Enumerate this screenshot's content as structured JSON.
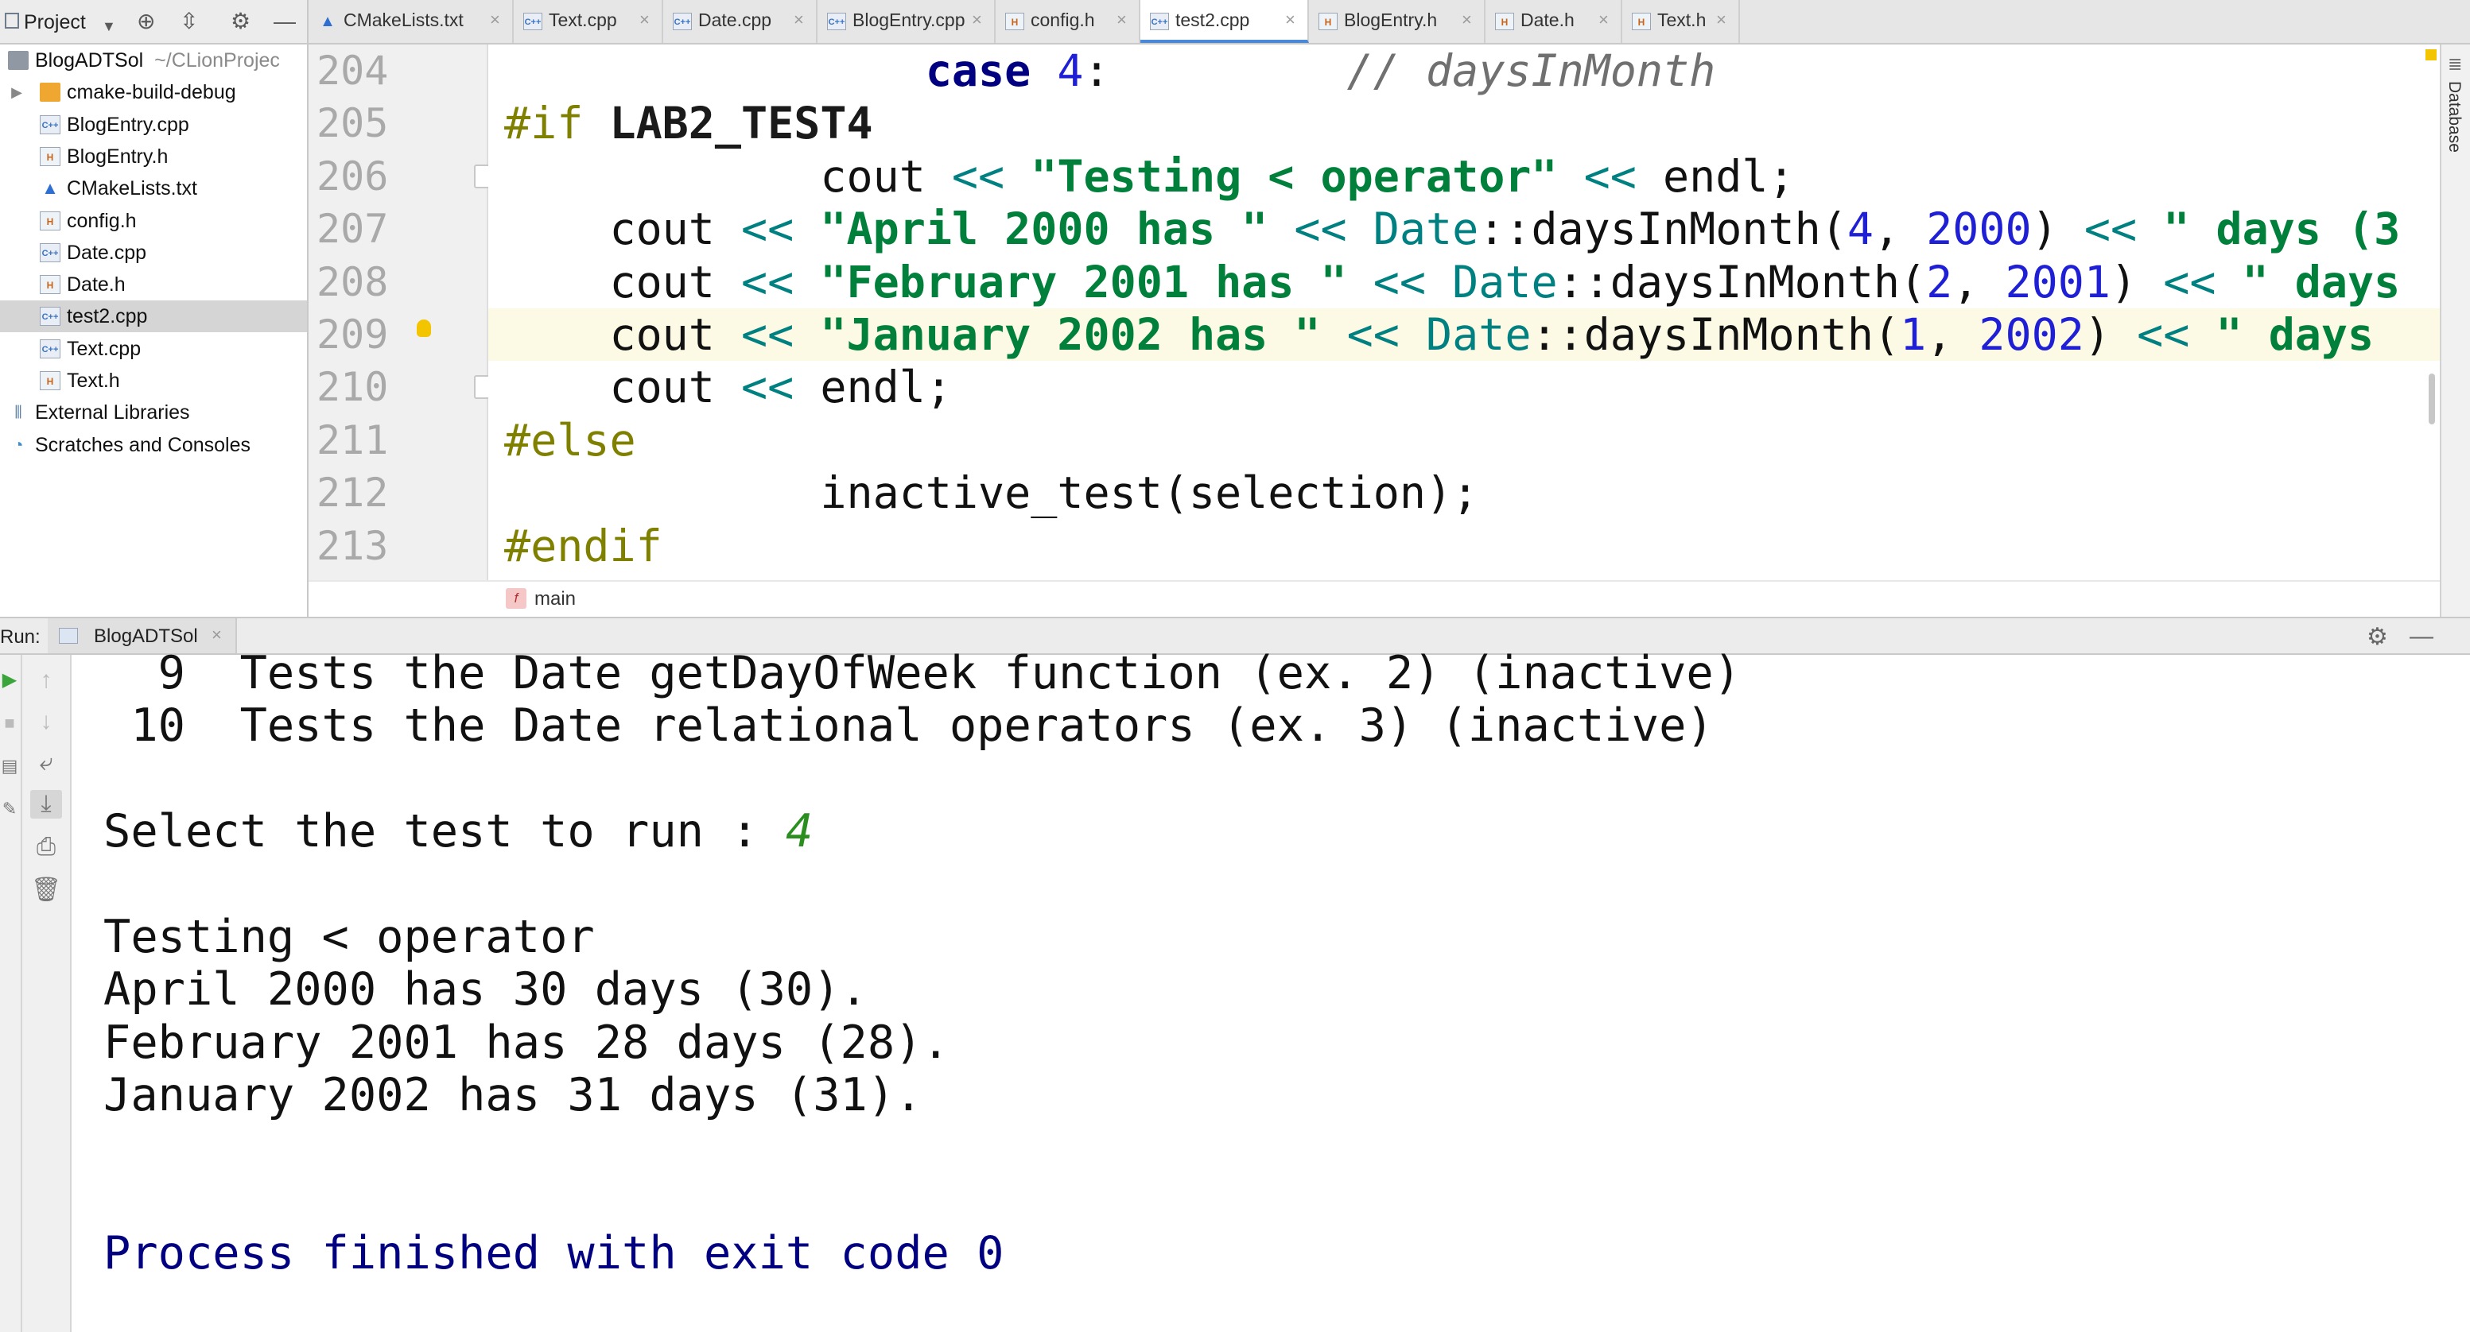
{
  "project_panel": {
    "title": "Project",
    "tree": [
      {
        "label": "BlogADTSol",
        "path": "~/CLionProjec",
        "type": "folder",
        "indent": 0
      },
      {
        "label": "cmake-build-debug",
        "type": "folder-orange",
        "indent": 1
      },
      {
        "label": "BlogEntry.cpp",
        "type": "cpp",
        "indent": 1
      },
      {
        "label": "BlogEntry.h",
        "type": "h",
        "indent": 1
      },
      {
        "label": "CMakeLists.txt",
        "type": "cmake",
        "indent": 1
      },
      {
        "label": "config.h",
        "type": "h",
        "indent": 1
      },
      {
        "label": "Date.cpp",
        "type": "cpp",
        "indent": 1
      },
      {
        "label": "Date.h",
        "type": "h",
        "indent": 1
      },
      {
        "label": "test2.cpp",
        "type": "cpp",
        "indent": 1,
        "selected": true
      },
      {
        "label": "Text.cpp",
        "type": "cpp",
        "indent": 1
      },
      {
        "label": "Text.h",
        "type": "h",
        "indent": 1
      },
      {
        "label": "External Libraries",
        "type": "lib",
        "indent": 0
      },
      {
        "label": "Scratches and Consoles",
        "type": "scratch",
        "indent": 0
      }
    ]
  },
  "editor_tabs": [
    {
      "label": "CMakeLists.txt",
      "type": "cmake"
    },
    {
      "label": "Text.cpp",
      "type": "cpp"
    },
    {
      "label": "Date.cpp",
      "type": "cpp"
    },
    {
      "label": "BlogEntry.cpp",
      "type": "cpp"
    },
    {
      "label": "config.h",
      "type": "h"
    },
    {
      "label": "test2.cpp",
      "type": "cpp",
      "active": true
    },
    {
      "label": "BlogEntry.h",
      "type": "h"
    },
    {
      "label": "Date.h",
      "type": "h"
    },
    {
      "label": "Text.h",
      "type": "h"
    }
  ],
  "tool_strip": {
    "database_label": "Database"
  },
  "editor": {
    "current_line": 209,
    "lines": [
      {
        "num": "204",
        "tokens": [
          [
            "",
            "                "
          ],
          [
            "kw",
            "case"
          ],
          [
            "",
            " "
          ],
          [
            "num",
            "4"
          ],
          [
            "",
            ":         "
          ],
          [
            "cmt",
            "// daysInMonth"
          ]
        ]
      },
      {
        "num": "205",
        "tokens": [
          [
            "pp",
            "#if "
          ],
          [
            "pp-b",
            "LAB2_TEST4"
          ]
        ]
      },
      {
        "num": "206",
        "tokens": [
          [
            "",
            "            cout "
          ],
          [
            "op",
            "<<"
          ],
          [
            "",
            " "
          ],
          [
            "str",
            "\"Testing < operator\""
          ],
          [
            "",
            " "
          ],
          [
            "op",
            "<<"
          ],
          [
            "",
            " endl;"
          ]
        ]
      },
      {
        "num": "207",
        "tokens": [
          [
            "",
            "    cout "
          ],
          [
            "op",
            "<<"
          ],
          [
            "",
            " "
          ],
          [
            "str",
            "\"April 2000 has \""
          ],
          [
            "",
            " "
          ],
          [
            "op",
            "<<"
          ],
          [
            "",
            " "
          ],
          [
            "cls",
            "Date"
          ],
          [
            "",
            "::daysInMonth("
          ],
          [
            "num",
            "4"
          ],
          [
            "",
            ", "
          ],
          [
            "num",
            "2000"
          ],
          [
            "",
            ") "
          ],
          [
            "op",
            "<<"
          ],
          [
            "",
            " "
          ],
          [
            "str",
            "\" days (3"
          ]
        ]
      },
      {
        "num": "208",
        "tokens": [
          [
            "",
            "    cout "
          ],
          [
            "op",
            "<<"
          ],
          [
            "",
            " "
          ],
          [
            "str",
            "\"February 2001 has \""
          ],
          [
            "",
            " "
          ],
          [
            "op",
            "<<"
          ],
          [
            "",
            " "
          ],
          [
            "cls",
            "Date"
          ],
          [
            "",
            "::daysInMonth("
          ],
          [
            "num",
            "2"
          ],
          [
            "",
            ", "
          ],
          [
            "num",
            "2001"
          ],
          [
            "",
            ") "
          ],
          [
            "op",
            "<<"
          ],
          [
            "",
            " "
          ],
          [
            "str",
            "\" days"
          ]
        ]
      },
      {
        "num": "209",
        "tokens": [
          [
            "",
            "    cout "
          ],
          [
            "op",
            "<<"
          ],
          [
            "",
            " "
          ],
          [
            "str",
            "\"January 2002 has \""
          ],
          [
            "",
            " "
          ],
          [
            "op",
            "<<"
          ],
          [
            "",
            " "
          ],
          [
            "cls",
            "Date"
          ],
          [
            "",
            "::daysInMonth("
          ],
          [
            "num",
            "1"
          ],
          [
            "",
            ", "
          ],
          [
            "num",
            "2002"
          ],
          [
            "",
            ") "
          ],
          [
            "op",
            "<<"
          ],
          [
            "",
            " "
          ],
          [
            "str",
            "\" days"
          ]
        ]
      },
      {
        "num": "210",
        "tokens": [
          [
            "",
            "    cout "
          ],
          [
            "op",
            "<<"
          ],
          [
            "",
            " endl;"
          ]
        ]
      },
      {
        "num": "211",
        "tokens": [
          [
            "pp",
            "#else"
          ]
        ]
      },
      {
        "num": "212",
        "tokens": [
          [
            "",
            "            inactive_test(selection);"
          ]
        ]
      },
      {
        "num": "213",
        "tokens": [
          [
            "pp",
            "#endif"
          ]
        ]
      }
    ],
    "breadcrumb": "main",
    "breadcrumb_badge": "f"
  },
  "run_panel": {
    "label": "Run:",
    "tab_label": "BlogADTSol",
    "output": [
      {
        "text": "  9  Tests the Date getDayOfWeek function (ex. 2) (inactive)"
      },
      {
        "text": " 10  Tests the Date relational operators (ex. 3) (inactive)"
      },
      {
        "text": ""
      },
      {
        "text": "Select the test to run : ",
        "input": "4"
      },
      {
        "text": ""
      },
      {
        "text": "Testing < operator"
      },
      {
        "text": "April 2000 has 30 days (30)."
      },
      {
        "text": "February 2001 has 28 days (28)."
      },
      {
        "text": "January 2002 has 31 days (31)."
      },
      {
        "text": ""
      },
      {
        "text": ""
      },
      {
        "text": "Process finished with exit code 0",
        "style": "done"
      }
    ]
  }
}
